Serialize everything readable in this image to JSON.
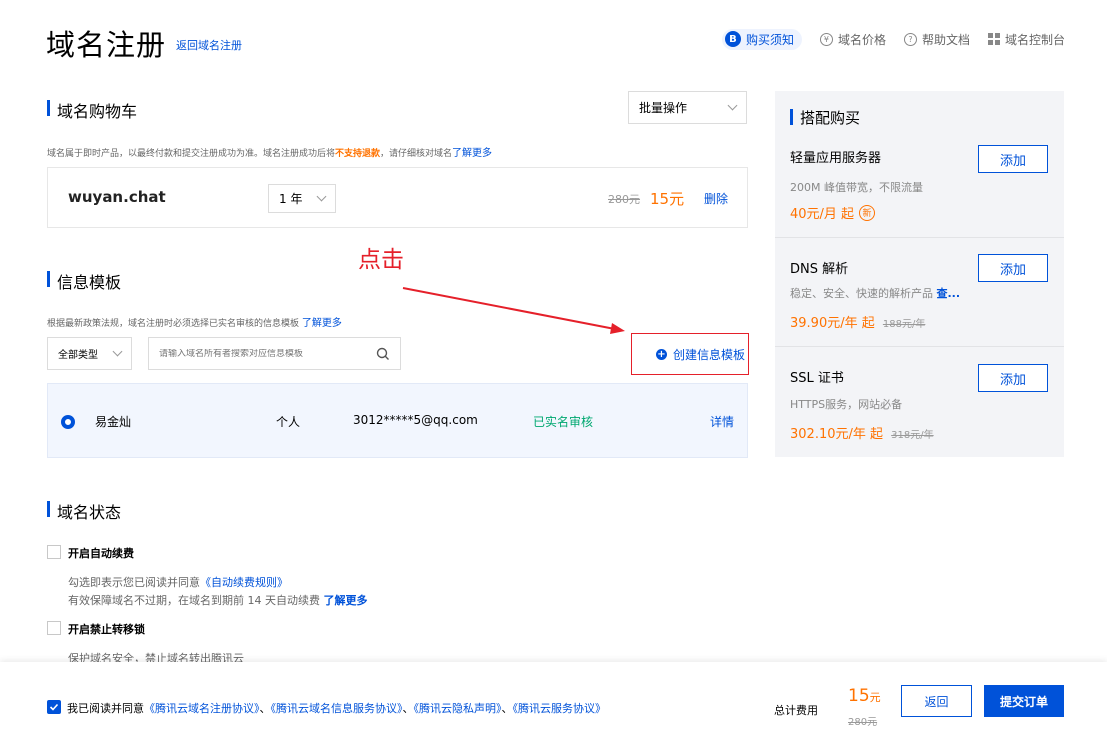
{
  "header": {
    "title": "域名注册",
    "back_link": "返回域名注册",
    "nav": [
      {
        "label": "购买须知",
        "active": true
      },
      {
        "label": "域名价格",
        "active": false
      },
      {
        "label": "帮助文档",
        "active": false
      },
      {
        "label": "域名控制台",
        "active": false
      }
    ]
  },
  "cart": {
    "title": "域名购物车",
    "batch_label": "批量操作",
    "notice_pre": "域名属于即时产品，以最终付款和提交注册成功为准。域名注册成功后将",
    "notice_warn": "不支持退款",
    "notice_post": "，请仔细核对域名",
    "notice_link": "了解更多",
    "item": {
      "domain": "wuyan.chat",
      "period": "1 年",
      "orig_price": "280元",
      "price": "15元",
      "delete": "删除"
    }
  },
  "annotation": {
    "label": "点击"
  },
  "template": {
    "title": "信息模板",
    "notice": "根据最新政策法规，域名注册时必须选择已实名审核的信息模板",
    "notice_link": "了解更多",
    "type_select": "全部类型",
    "search_placeholder": "请输入域名所有者搜索对应信息模板",
    "create_btn": "创建信息模板",
    "row": {
      "name": "易金灿",
      "type": "个人",
      "email": "3012*****5@qq.com",
      "status": "已实名审核",
      "detail": "详情"
    }
  },
  "status": {
    "title": "域名状态",
    "auto_renew": {
      "label": "开启自动续费",
      "desc1_pre": "勾选即表示您已阅读并同意",
      "desc1_link": "《自动续费规则》",
      "desc2_pre": "有效保障域名不过期，在域名到期前 14 天自动续费",
      "desc2_link": "了解更多"
    },
    "transfer_lock": {
      "label": "开启禁止转移锁",
      "desc": "保护域名安全，禁止域名转出腾讯云"
    }
  },
  "bundle": {
    "title": "搭配购买",
    "items": [
      {
        "name": "轻量应用服务器",
        "desc": "200M 峰值带宽，不限流量",
        "price": "40元/月 起",
        "badge": "新",
        "orig": "",
        "add": "添加"
      },
      {
        "name": "DNS 解析",
        "desc": "稳定、安全、快速的解析产品",
        "desc_link": "查...",
        "price": "39.90元/年 起",
        "orig": "188元/年",
        "add": "添加"
      },
      {
        "name": "SSL 证书",
        "desc": "HTTPS服务，网站必备",
        "price": "302.10元/年 起",
        "orig": "318元/年",
        "add": "添加"
      }
    ]
  },
  "footer": {
    "agree_pre": "我已阅读并同意",
    "agreements": [
      "《腾讯云域名注册协议》",
      "《腾讯云域名信息服务协议》",
      "《腾讯云隐私声明》",
      "《腾讯云服务协议》"
    ],
    "sep": "、",
    "total_label": "总计费用",
    "total_price": "15",
    "total_unit": "元",
    "total_orig": "280元",
    "back_btn": "返回",
    "submit_btn": "提交订单"
  },
  "colors": {
    "brand": "#0052d9",
    "price": "#ff7200",
    "annotation": "#e5202a",
    "success": "#00a870"
  }
}
